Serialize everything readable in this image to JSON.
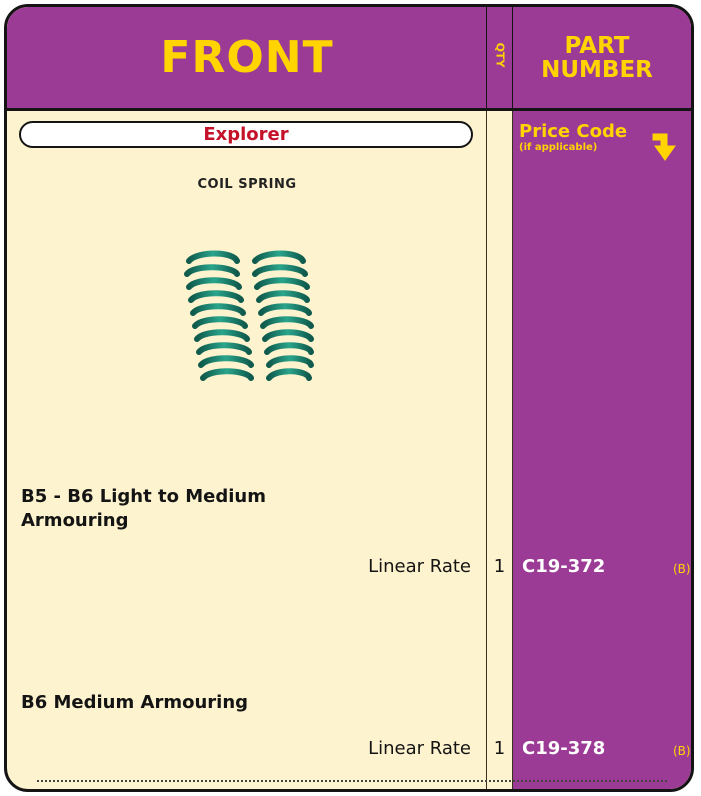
{
  "header": {
    "front": "FRONT",
    "qty": "QTY",
    "part_number_line1": "PART",
    "part_number_line2": "NUMBER"
  },
  "vehicle": "Explorer",
  "part_title": "COIL SPRING",
  "image": {
    "icon": "coil-springs-image",
    "spring_color": "#1f7a68"
  },
  "price_code": {
    "label": "Price Code",
    "sub": "(if applicable)",
    "icon": "arrow-turn-down-icon"
  },
  "rows": [
    {
      "heading": "B5 - B6 Light to Medium Armouring",
      "rate": "Linear Rate",
      "qty": "1",
      "part_number": "C19-372",
      "price_code": "(B)"
    },
    {
      "heading": "B6 Medium Armouring",
      "rate": "Linear Rate",
      "qty": "1",
      "part_number": "C19-378",
      "price_code": "(B)"
    }
  ],
  "colors": {
    "purple": "#9b3b95",
    "yellow": "#ffd400",
    "cream": "#fdf3ce",
    "red": "#c4122a"
  }
}
